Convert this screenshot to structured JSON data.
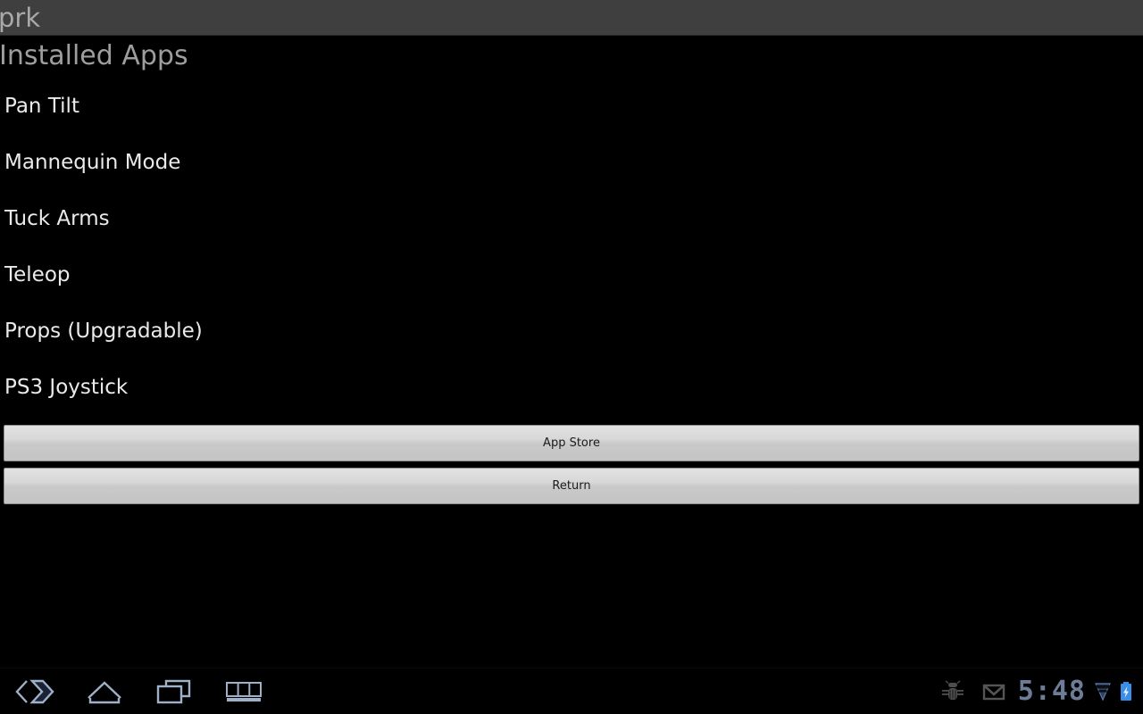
{
  "window": {
    "title": "prk"
  },
  "page": {
    "heading": "Installed Apps"
  },
  "app_list": {
    "items": [
      {
        "label": "Pan Tilt"
      },
      {
        "label": "Mannequin Mode"
      },
      {
        "label": "Tuck Arms"
      },
      {
        "label": "Teleop"
      },
      {
        "label": "Props (Upgradable)"
      },
      {
        "label": "PS3 Joystick"
      }
    ]
  },
  "buttons": {
    "app_store_label": "App Store",
    "return_label": "Return"
  },
  "system_bar": {
    "nav": [
      {
        "name": "back-icon",
        "label": "Back"
      },
      {
        "name": "home-icon",
        "label": "Home"
      },
      {
        "name": "recent-apps-icon",
        "label": "Recent Apps"
      },
      {
        "name": "keyboard-icon",
        "label": "Keyboard"
      }
    ],
    "status": {
      "debug_icon": "android-bug-icon",
      "mail_icon": "gmail-icon",
      "clock": "5:48",
      "signal_icon": "signal-icon",
      "battery_icon": "battery-charging-icon"
    }
  },
  "colors": {
    "background": "#000000",
    "titlebar": "#3f3f3f",
    "titlebar_text": "#a9a9a9",
    "heading_text": "#9e9e9e",
    "list_text": "#eaeaea",
    "button_face": "#d6d6d6",
    "button_text": "#1b1b1b",
    "nav_icon": "#9fb0c9",
    "clock_text": "#6e7d97",
    "battery_accent": "#3b8ee8"
  }
}
